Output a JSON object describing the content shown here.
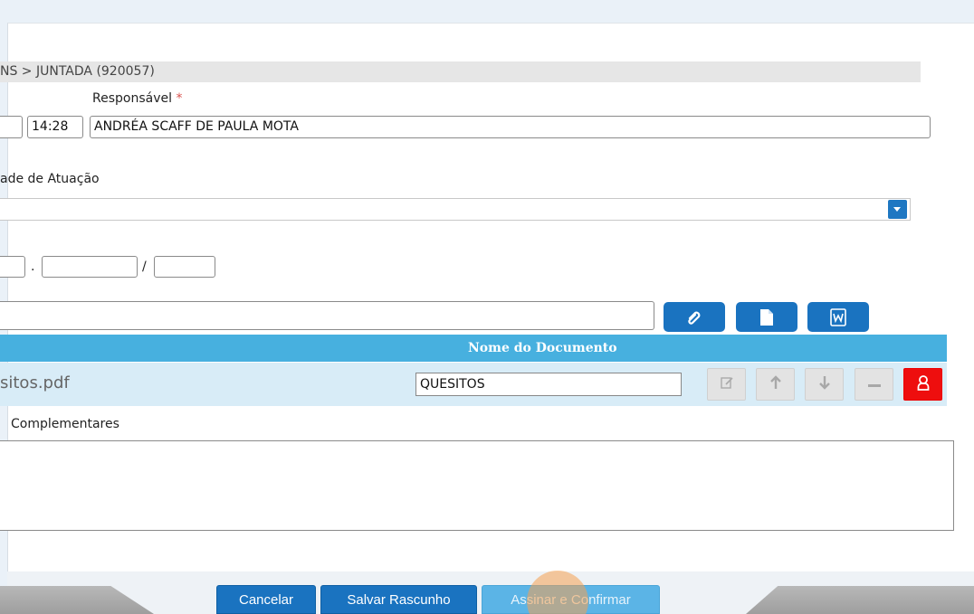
{
  "breadcrumb": "NS > JUNTADA (920057)",
  "responsavel": {
    "label": "Responsável",
    "required_mark": "*",
    "time_value": "14:28",
    "name_value": "ANDRÉA SCAFF DE PAULA MOTA"
  },
  "atuacao": {
    "label": "ade de Atuação"
  },
  "numero": {
    "separator_dot": ".",
    "separator_slash": "/"
  },
  "table": {
    "header": "Nome do Documento",
    "rows": [
      {
        "file_name": "sitos.pdf",
        "doc_name": "QUESITOS"
      }
    ]
  },
  "complementares": {
    "label": "Complementares"
  },
  "actions": {
    "cancel": "Cancelar",
    "save_draft": "Salvar Rascunho",
    "sign_confirm": "Assinar e Confirmar"
  },
  "icons": {
    "attach": "paperclip-icon",
    "new_doc": "document-icon",
    "word_doc": "word-document-icon",
    "edit": "edit-icon",
    "up": "arrow-up-icon",
    "down": "arrow-down-icon",
    "remove": "minus-icon",
    "sign": "user-icon"
  },
  "colors": {
    "primary": "#1a73c0",
    "table_header": "#47b0df",
    "row_bg": "#d8ecf7",
    "danger": "#ee0e0e"
  }
}
